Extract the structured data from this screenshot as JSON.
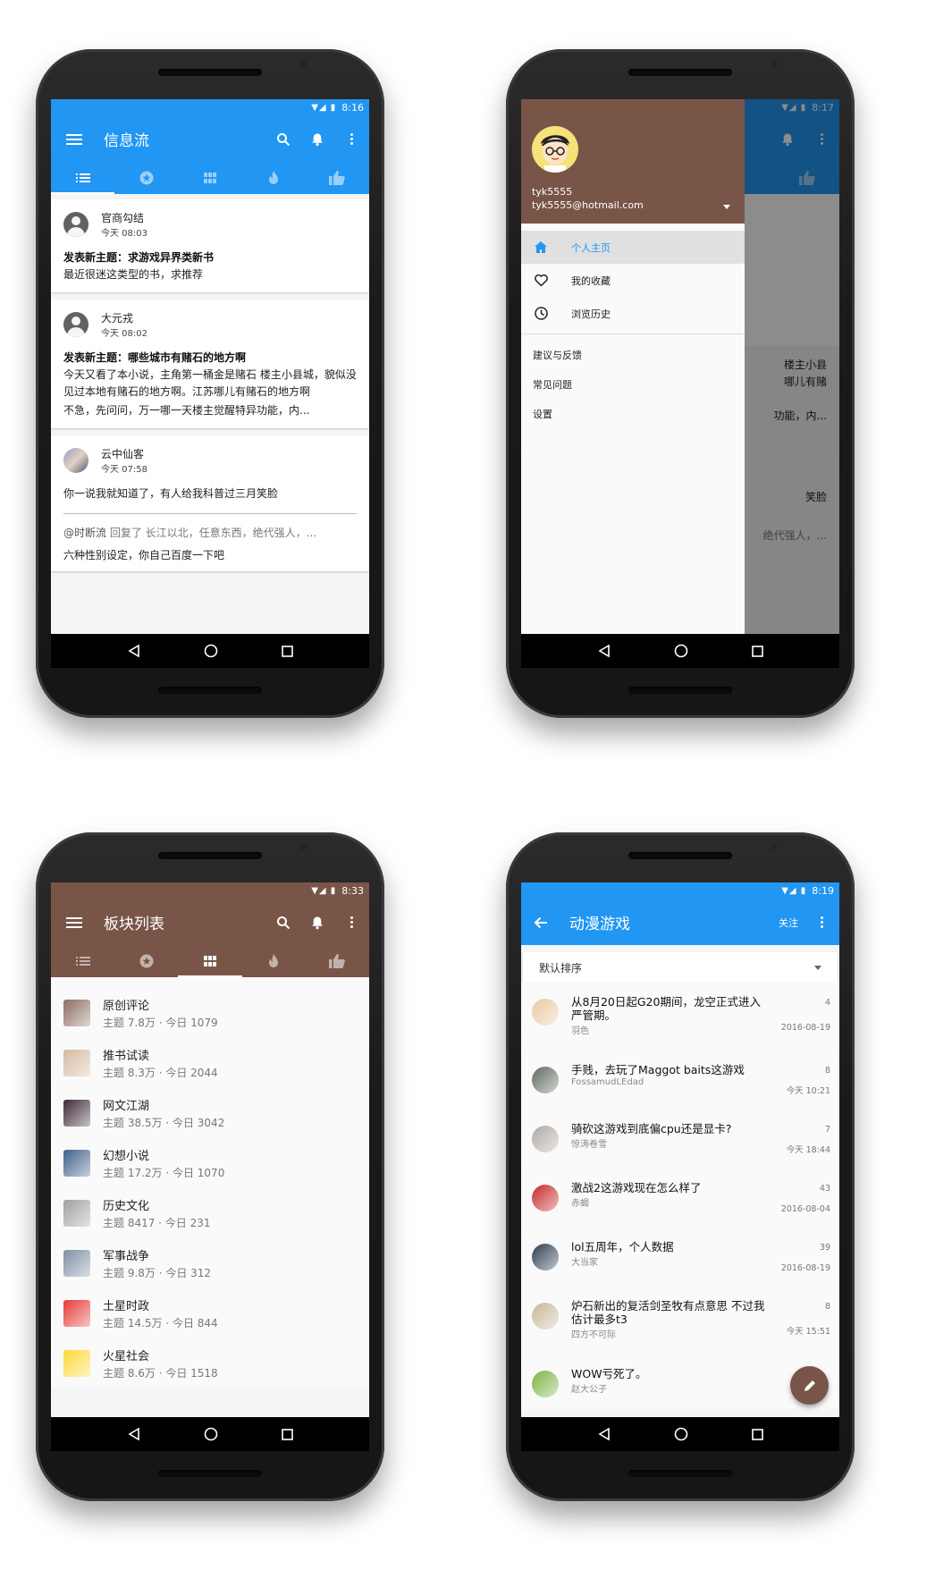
{
  "nav": {
    "back": "back",
    "home": "home",
    "recent": "recent"
  },
  "phone1": {
    "status_time": "8:16",
    "title": "信息流",
    "cards": [
      {
        "name": "官商勾结",
        "time": "今天 08:03",
        "subject": "发表新主题：求游戏异界类新书",
        "body": "最近很迷这类型的书，求推荐"
      },
      {
        "name": "大元戎",
        "time": "今天 08:02",
        "subject": "发表新主题：哪些城市有赌石的地方啊",
        "body": "今天又看了本小说，主角第一桶金是赌石 楼主小县城，貌似没见过本地有赌石的地方啊。江苏哪儿有赌石的地方啊",
        "body2": "不急，先问问，万一哪一天楼主觉醒特异功能，内..."
      }
    ],
    "card3": {
      "name": "云中仙客",
      "time": "今天 07:58",
      "body": "你一说我就知道了，有人给我科普过三月笑脸",
      "quote_user": "@时断流",
      "quote_text": " 回复了 长江以北，任意东西，绝代强人，...",
      "reply": "六种性别设定，你自己百度一下吧"
    }
  },
  "phone2": {
    "status_time": "8:17",
    "username": "tyk5555",
    "email": "tyk5555@hotmail.com",
    "menu": [
      {
        "label": "个人主页",
        "icon": "home-icon"
      },
      {
        "label": "我的收藏",
        "icon": "heart-icon"
      },
      {
        "label": "浏览历史",
        "icon": "clock-icon"
      }
    ],
    "links": [
      "建议与反馈",
      "常见问题",
      "设置"
    ],
    "behind": [
      "楼主小县",
      "哪儿有赌",
      "功能，内...",
      "笑脸",
      "绝代强人，..."
    ]
  },
  "phone3": {
    "status_time": "8:33",
    "title": "板块列表",
    "forums": [
      {
        "name": "原创评论",
        "meta": "主题 7.8万 · 今日 1079",
        "color": "#8d6e63"
      },
      {
        "name": "推书试读",
        "meta": "主题 8.3万 · 今日 2044",
        "color": "#d7b9a0"
      },
      {
        "name": "网文江湖",
        "meta": "主题 38.5万 · 今日 3042",
        "color": "#3e2a3a"
      },
      {
        "name": "幻想小说",
        "meta": "主题 17.2万 · 今日 1070",
        "color": "#3f5f8a"
      },
      {
        "name": "历史文化",
        "meta": "主题 8417 · 今日 231",
        "color": "#a0a0a0"
      },
      {
        "name": "军事战争",
        "meta": "主题 9.8万 · 今日 312",
        "color": "#7f8fa6"
      },
      {
        "name": "土星时政",
        "meta": "主题 14.5万 · 今日 844",
        "color": "#e53935"
      },
      {
        "name": "火星社会",
        "meta": "主题 8.6万 · 今日 1518",
        "color": "#fdd835"
      }
    ]
  },
  "phone4": {
    "status_time": "8:19",
    "title": "动漫游戏",
    "follow": "关注",
    "sort": "默认排序",
    "topics": [
      {
        "title": "从8月20日起G20期间，龙空正式进入严管期。",
        "user": "羽色",
        "count": "4",
        "date": "2016-08-19",
        "color": "#e8c9a0"
      },
      {
        "title": "手贱，去玩了Maggot baits这游戏",
        "user": "FossamudLEdad",
        "count": "8",
        "date": "今天 10:21",
        "color": "#5d6b5f"
      },
      {
        "title": "骑砍这游戏到底偏cpu还是显卡?",
        "user": "惊涛卷雪",
        "count": "7",
        "date": "今天 18:44",
        "color": "#b0aaa4"
      },
      {
        "title": "激战2这游戏现在怎么样了",
        "user": "赤蝎",
        "count": "43",
        "date": "2016-08-04",
        "color": "#c62828"
      },
      {
        "title": "lol五周年，个人数据",
        "user": "大当家",
        "count": "39",
        "date": "2016-08-19",
        "color": "#2c3e50"
      },
      {
        "title": "炉石新出的复活剑圣牧有点意思 不过我估计最多t3",
        "user": "四方不可际",
        "count": "8",
        "date": "今天 15:51",
        "color": "#c8b89a"
      },
      {
        "title": "WOW亏死了。",
        "user": "赵大公子",
        "count": "",
        "date": "",
        "color": "#7cb342"
      }
    ]
  }
}
